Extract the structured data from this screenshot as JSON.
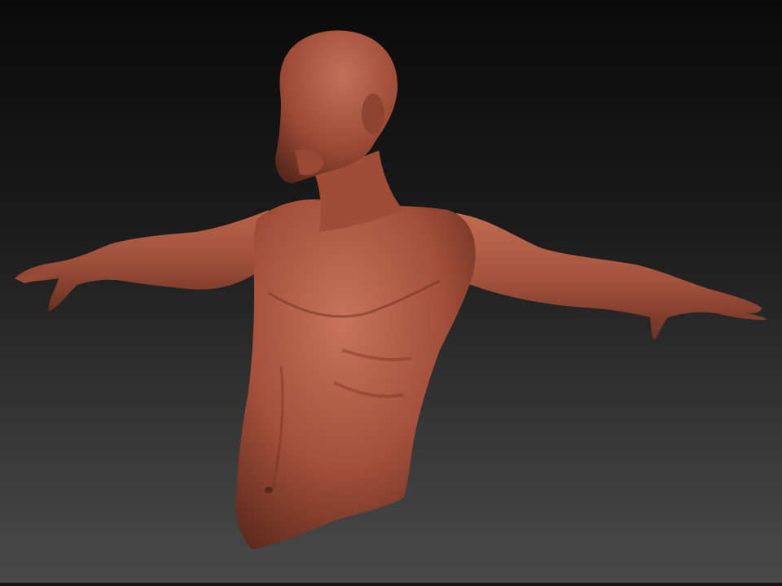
{
  "viewport": {
    "background_top": "#0a0a0a",
    "background_bottom": "#4a4a4a"
  },
  "model": {
    "material_color": "#a4503a",
    "highlight_color": "#c8735a",
    "shadow_color": "#5e2a1d"
  }
}
